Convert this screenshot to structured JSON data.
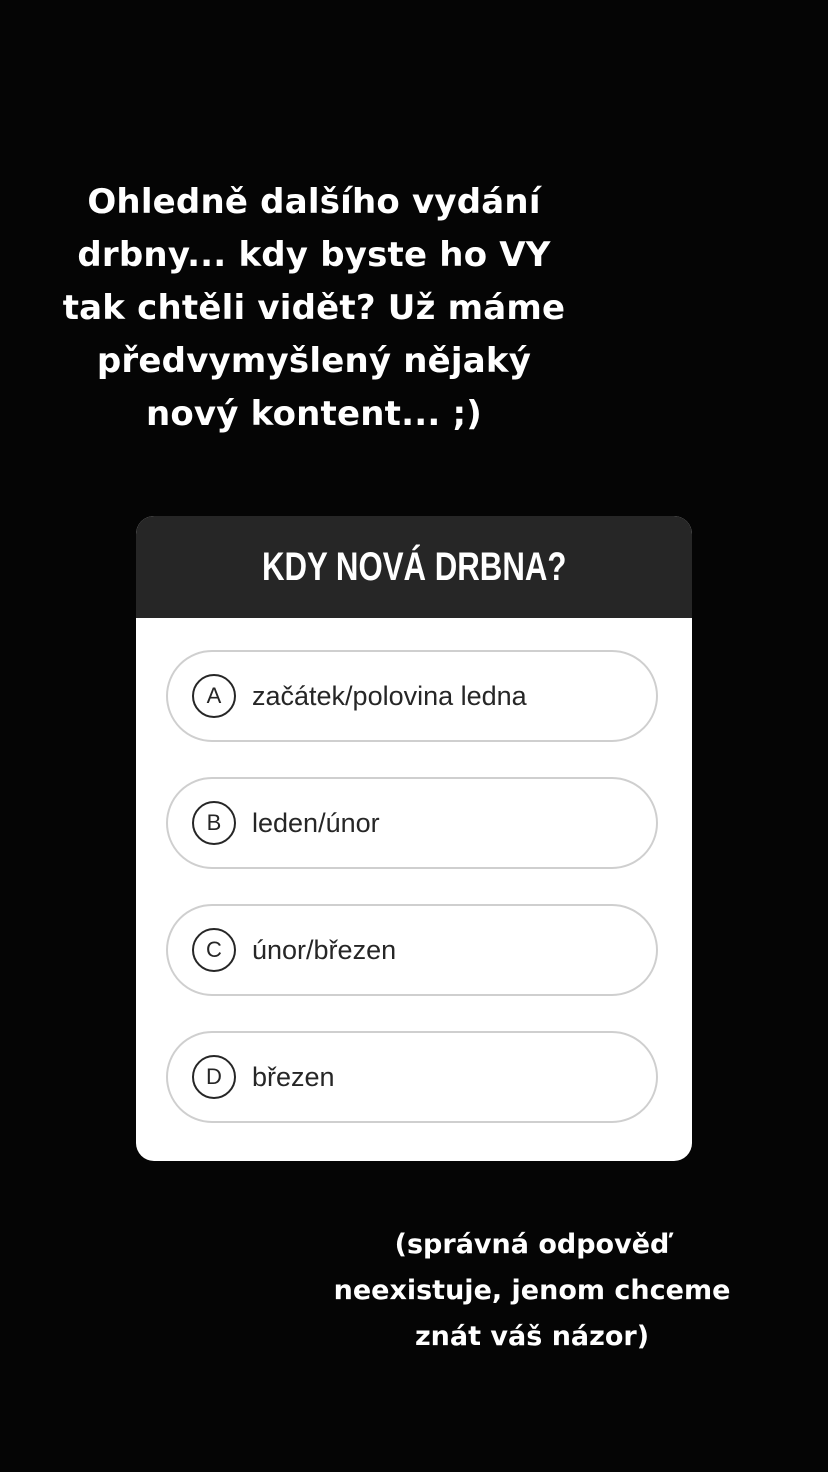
{
  "story": {
    "caption_top": "Ohledně dalšího vydání drbny... kdy byste ho VY tak chtěli vidět? Už máme předvymyšlený nějaký nový kontent... ;)",
    "caption_bottom": "(správná odpověď neexistuje, jenom chceme znát váš názor)"
  },
  "quiz": {
    "title": "KDY NOVÁ DRBNA?",
    "options": [
      {
        "letter": "A",
        "label": "začátek/polovina ledna"
      },
      {
        "letter": "B",
        "label": "leden/únor"
      },
      {
        "letter": "C",
        "label": "únor/březen"
      },
      {
        "letter": "D",
        "label": "březen"
      }
    ]
  },
  "colors": {
    "background": "#050505",
    "header": "#262626",
    "card": "#ffffff",
    "option_border": "#cfcfcf",
    "text_dark": "#262626",
    "text_light": "#ffffff"
  }
}
